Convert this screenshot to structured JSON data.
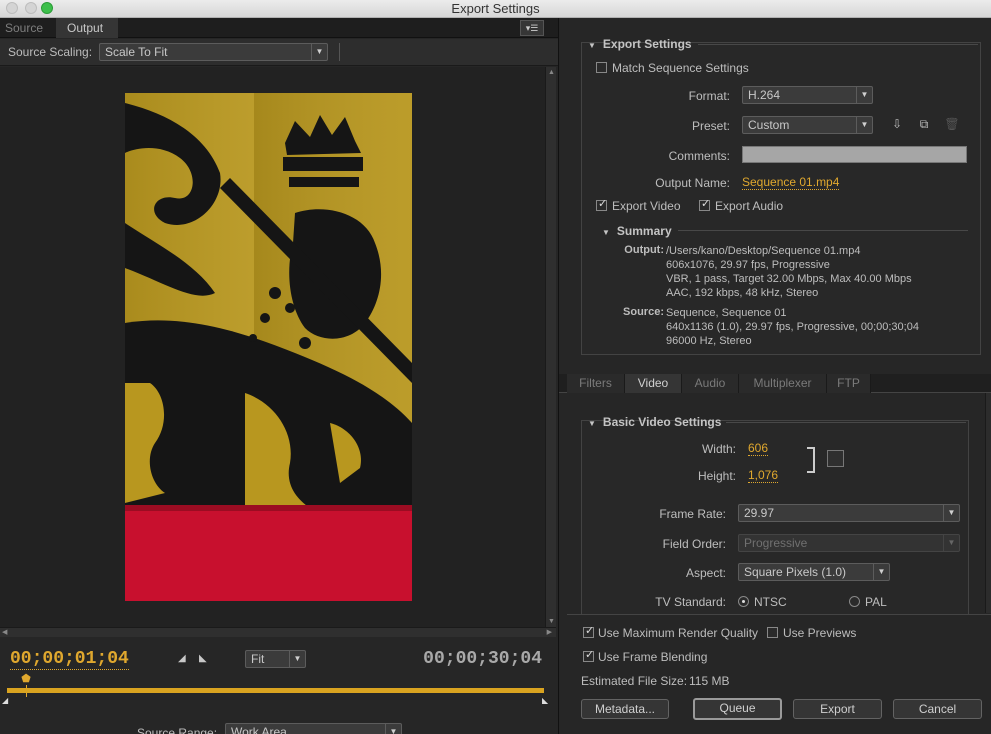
{
  "window": {
    "title": "Export Settings"
  },
  "left": {
    "tabs": [
      {
        "label": "Source"
      },
      {
        "label": "Output"
      }
    ],
    "source_scaling": {
      "label": "Source Scaling:",
      "value": "Scale To Fit"
    },
    "timecode_current": "00;00;01;04",
    "timecode_duration": "00;00;30;04",
    "zoom": "Fit",
    "source_range": {
      "label": "Source Range:",
      "value": "Work Area"
    }
  },
  "export_settings": {
    "heading": "Export Settings",
    "match_sequence": {
      "label": "Match Sequence Settings",
      "checked": false
    },
    "format": {
      "label": "Format:",
      "value": "H.264"
    },
    "preset": {
      "label": "Preset:",
      "value": "Custom"
    },
    "comments": {
      "label": "Comments:",
      "value": ""
    },
    "output_name": {
      "label": "Output Name:",
      "value": "Sequence 01.mp4"
    },
    "export_video": {
      "label": "Export Video",
      "checked": true
    },
    "export_audio": {
      "label": "Export Audio",
      "checked": true
    },
    "summary": {
      "heading": "Summary",
      "output_label": "Output:",
      "output_lines": [
        "/Users/kano/Desktop/Sequence 01.mp4",
        "606x1076, 29.97 fps, Progressive",
        "VBR, 1 pass, Target 32.00 Mbps, Max 40.00 Mbps",
        "AAC, 192 kbps, 48 kHz, Stereo"
      ],
      "source_label": "Source:",
      "source_lines": [
        "Sequence, Sequence 01",
        "640x1136 (1.0), 29.97 fps, Progressive, 00;00;30;04",
        "96000 Hz, Stereo"
      ]
    }
  },
  "tabs": [
    {
      "label": "Filters"
    },
    {
      "label": "Video"
    },
    {
      "label": "Audio"
    },
    {
      "label": "Multiplexer"
    },
    {
      "label": "FTP"
    }
  ],
  "video": {
    "heading": "Basic Video Settings",
    "width": {
      "label": "Width:",
      "value": "606"
    },
    "height": {
      "label": "Height:",
      "value": "1,076"
    },
    "frame_rate": {
      "label": "Frame Rate:",
      "value": "29.97"
    },
    "field_order": {
      "label": "Field Order:",
      "value": "Progressive"
    },
    "aspect": {
      "label": "Aspect:",
      "value": "Square Pixels (1.0)"
    },
    "tv_standard": {
      "label": "TV Standard:",
      "ntsc": "NTSC",
      "pal": "PAL",
      "selected": "NTSC"
    }
  },
  "bottom": {
    "max_render_quality": {
      "label": "Use Maximum Render Quality",
      "checked": true
    },
    "use_previews": {
      "label": "Use Previews",
      "checked": false
    },
    "frame_blending": {
      "label": "Use Frame Blending",
      "checked": true
    },
    "estimated_size": {
      "label": "Estimated File Size:",
      "value": "115 MB"
    },
    "buttons": {
      "metadata": "Metadata...",
      "queue": "Queue",
      "export": "Export",
      "cancel": "Cancel"
    }
  },
  "colors": {
    "accent": "#e0a82e",
    "flag_yellow": "#b8971f",
    "flag_red": "#c8102e",
    "flag_black": "#111111"
  },
  "icons": [
    "panel-menu-icon",
    "save-preset-icon",
    "import-preset-icon",
    "delete-preset-icon",
    "mark-in-icon",
    "mark-out-icon",
    "playhead-icon"
  ]
}
